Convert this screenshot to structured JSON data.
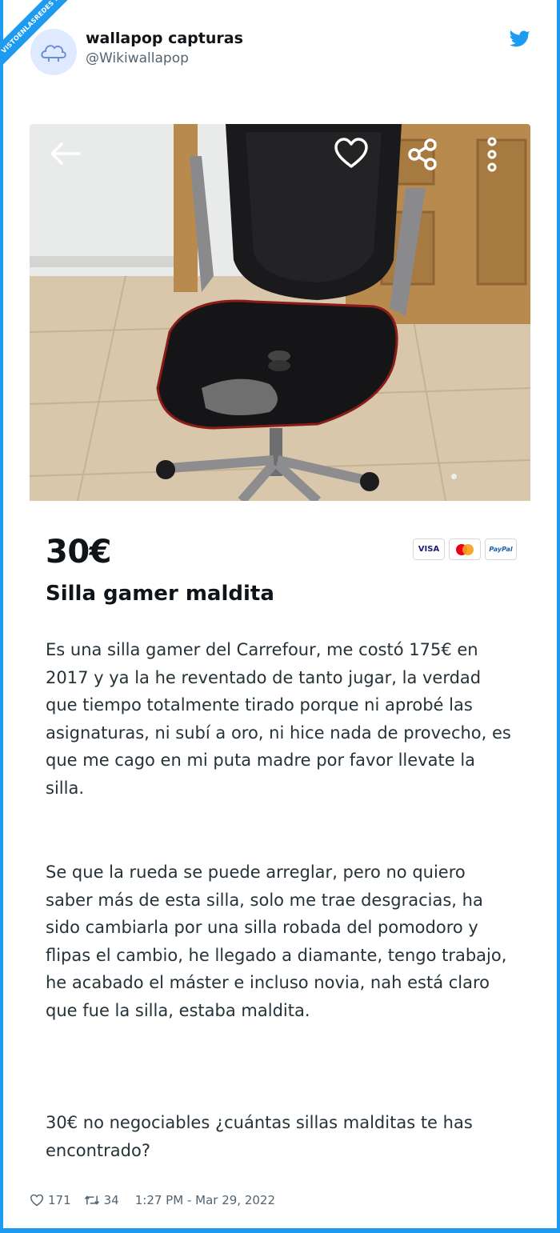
{
  "watermark": "VISTOENLASREDES .com",
  "tweet": {
    "display_name": "wallapop capturas",
    "handle": "@Wikiwallapop",
    "likes": "171",
    "retweets": "34",
    "timestamp": "1:27 PM - Mar 29, 2022"
  },
  "listing": {
    "price": "30€",
    "title": "Silla gamer maldita",
    "payment_methods": [
      "VISA",
      "mastercard",
      "PayPal"
    ],
    "description": [
      "Es una silla gamer del Carrefour, me costó 175€ en 2017 y ya la he reventado de tanto jugar, la verdad que tiempo totalmente tirado porque ni aprobé las asignaturas, ni subí a oro, ni hice nada de provecho, es que me cago en mi puta madre por favor llevate la silla.",
      "Se que la rueda se puede arreglar, pero no quiero saber más de esta silla, solo me trae desgracias, ha sido cambiarla por una silla robada del pomodoro y flipas el cambio, he llegado a diamante, tengo trabajo, he acabado el máster e incluso novia, nah está claro que fue la silla, estaba maldita.",
      "30€ no negociables ¿cuántas sillas malditas te has encontrado?"
    ]
  },
  "icons": {
    "back": "arrow-left-icon",
    "favorite": "heart-icon",
    "share": "share-icon",
    "more": "more-vertical-icon"
  },
  "colors": {
    "twitter_blue": "#1d9bf0",
    "text_dark": "#0f1419",
    "text_muted": "#536471"
  }
}
